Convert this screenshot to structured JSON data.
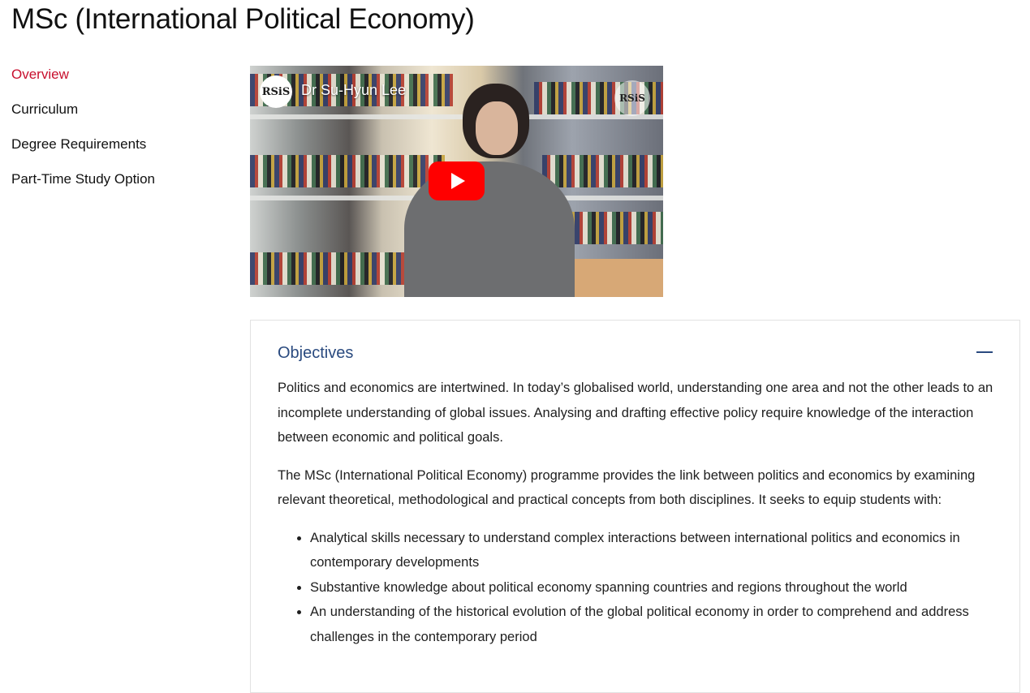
{
  "page": {
    "title": "MSc (International Political Economy)"
  },
  "sidebar": {
    "items": [
      {
        "label": "Overview",
        "active": true
      },
      {
        "label": "Curriculum",
        "active": false
      },
      {
        "label": "Degree Requirements",
        "active": false
      },
      {
        "label": "Part-Time Study Option",
        "active": false
      }
    ]
  },
  "video": {
    "logo_text": "RSiS",
    "title": "Dr Su-Hyun Lee",
    "corner_logo_text": "RSiS",
    "play_icon": "play-icon"
  },
  "objectives": {
    "title": "Objectives",
    "collapse_icon": "minus-icon",
    "paragraphs": [
      "Politics and economics are intertwined. In today’s globalised world, understanding one area and not the other leads to an incomplete understanding of global issues. Analysing and drafting effective policy require knowledge of the interaction between economic and political goals.",
      "The MSc (International Political Economy) programme provides the link between politics and economics by examining relevant theoretical, methodological and practical concepts from both disciplines. It seeks to equip students with:"
    ],
    "bullets": [
      "Analytical skills necessary to understand complex interactions between international politics and economics in contemporary developments",
      "Substantive knowledge about political economy spanning countries and regions throughout the world",
      "An understanding of the historical evolution of the global political economy in order to comprehend and address challenges in the contemporary period"
    ]
  },
  "colors": {
    "active_nav": "#c8102e",
    "heading_blue": "#2a4a7f",
    "play_red": "#ff0000"
  }
}
